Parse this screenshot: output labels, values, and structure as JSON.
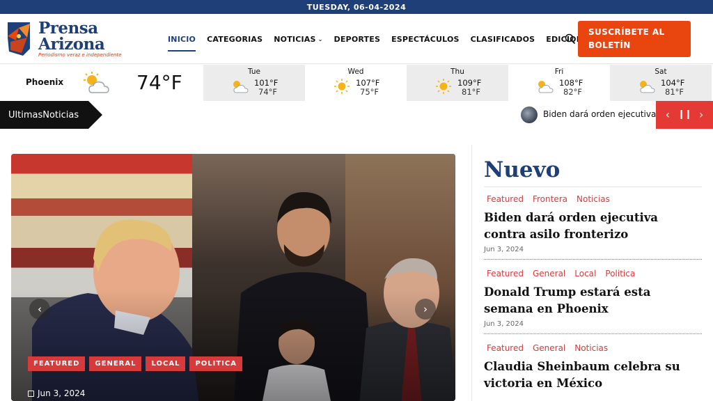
{
  "topbar": {
    "date": "TUESDAY, 06-04-2024"
  },
  "logo": {
    "line1": "Prensa",
    "line2": "Arizona",
    "tagline": "Periodismo veraz e independiente"
  },
  "nav": [
    {
      "label": "INICIO",
      "active": true
    },
    {
      "label": "CATEGORIAS"
    },
    {
      "label": "NOTICIAS",
      "caret": "⌄"
    },
    {
      "label": "DEPORTES"
    },
    {
      "label": "ESPECTÁCULOS"
    },
    {
      "label": "CLASIFICADOS"
    },
    {
      "label": "EDICIONES"
    }
  ],
  "subscribe": {
    "line1": "SUSCRÍBETE AL",
    "line2": "BOLETÍN"
  },
  "weather": {
    "city": "Phoenix",
    "current_temp": "74°F",
    "current_icon": "partly-cloudy-icon",
    "days": [
      {
        "name": "Tue",
        "hi": "101°F",
        "lo": "74°F",
        "icon": "partly-cloudy-icon"
      },
      {
        "name": "Wed",
        "hi": "107°F",
        "lo": "75°F",
        "icon": "sun-icon"
      },
      {
        "name": "Thu",
        "hi": "109°F",
        "lo": "81°F",
        "icon": "sun-icon"
      },
      {
        "name": "Fri",
        "hi": "108°F",
        "lo": "82°F",
        "icon": "partly-cloudy-icon"
      },
      {
        "name": "Sat",
        "hi": "104°F",
        "lo": "81°F",
        "icon": "partly-cloudy-icon"
      }
    ]
  },
  "ticker": {
    "label": "UltimasNoticias",
    "text": "Biden dará orden ejecutiva contra asilo fronterizo"
  },
  "hero": {
    "tags": [
      "FEATURED",
      "GENERAL",
      "LOCAL",
      "POLITICA"
    ],
    "date": "Jun 3, 2024",
    "colors": {
      "tag": "#d63a3a"
    }
  },
  "side": {
    "title": "Nuevo",
    "items": [
      {
        "cats": [
          "Featured",
          "Frontera",
          "Noticias"
        ],
        "headline": "Biden dará orden ejecutiva contra asilo fronterizo",
        "date": "Jun 3, 2024"
      },
      {
        "cats": [
          "Featured",
          "General",
          "Local",
          "Politica"
        ],
        "headline": "Donald Trump estará esta semana en Phoenix",
        "date": "Jun 3, 2024"
      },
      {
        "cats": [
          "Featured",
          "General",
          "Noticias"
        ],
        "headline": "Claudia Sheinbaum celebra su victoria en México",
        "date": ""
      }
    ]
  },
  "colors": {
    "brand_blue": "#1e3f78",
    "accent_orange": "#e8450f",
    "accent_red": "#e53935"
  }
}
